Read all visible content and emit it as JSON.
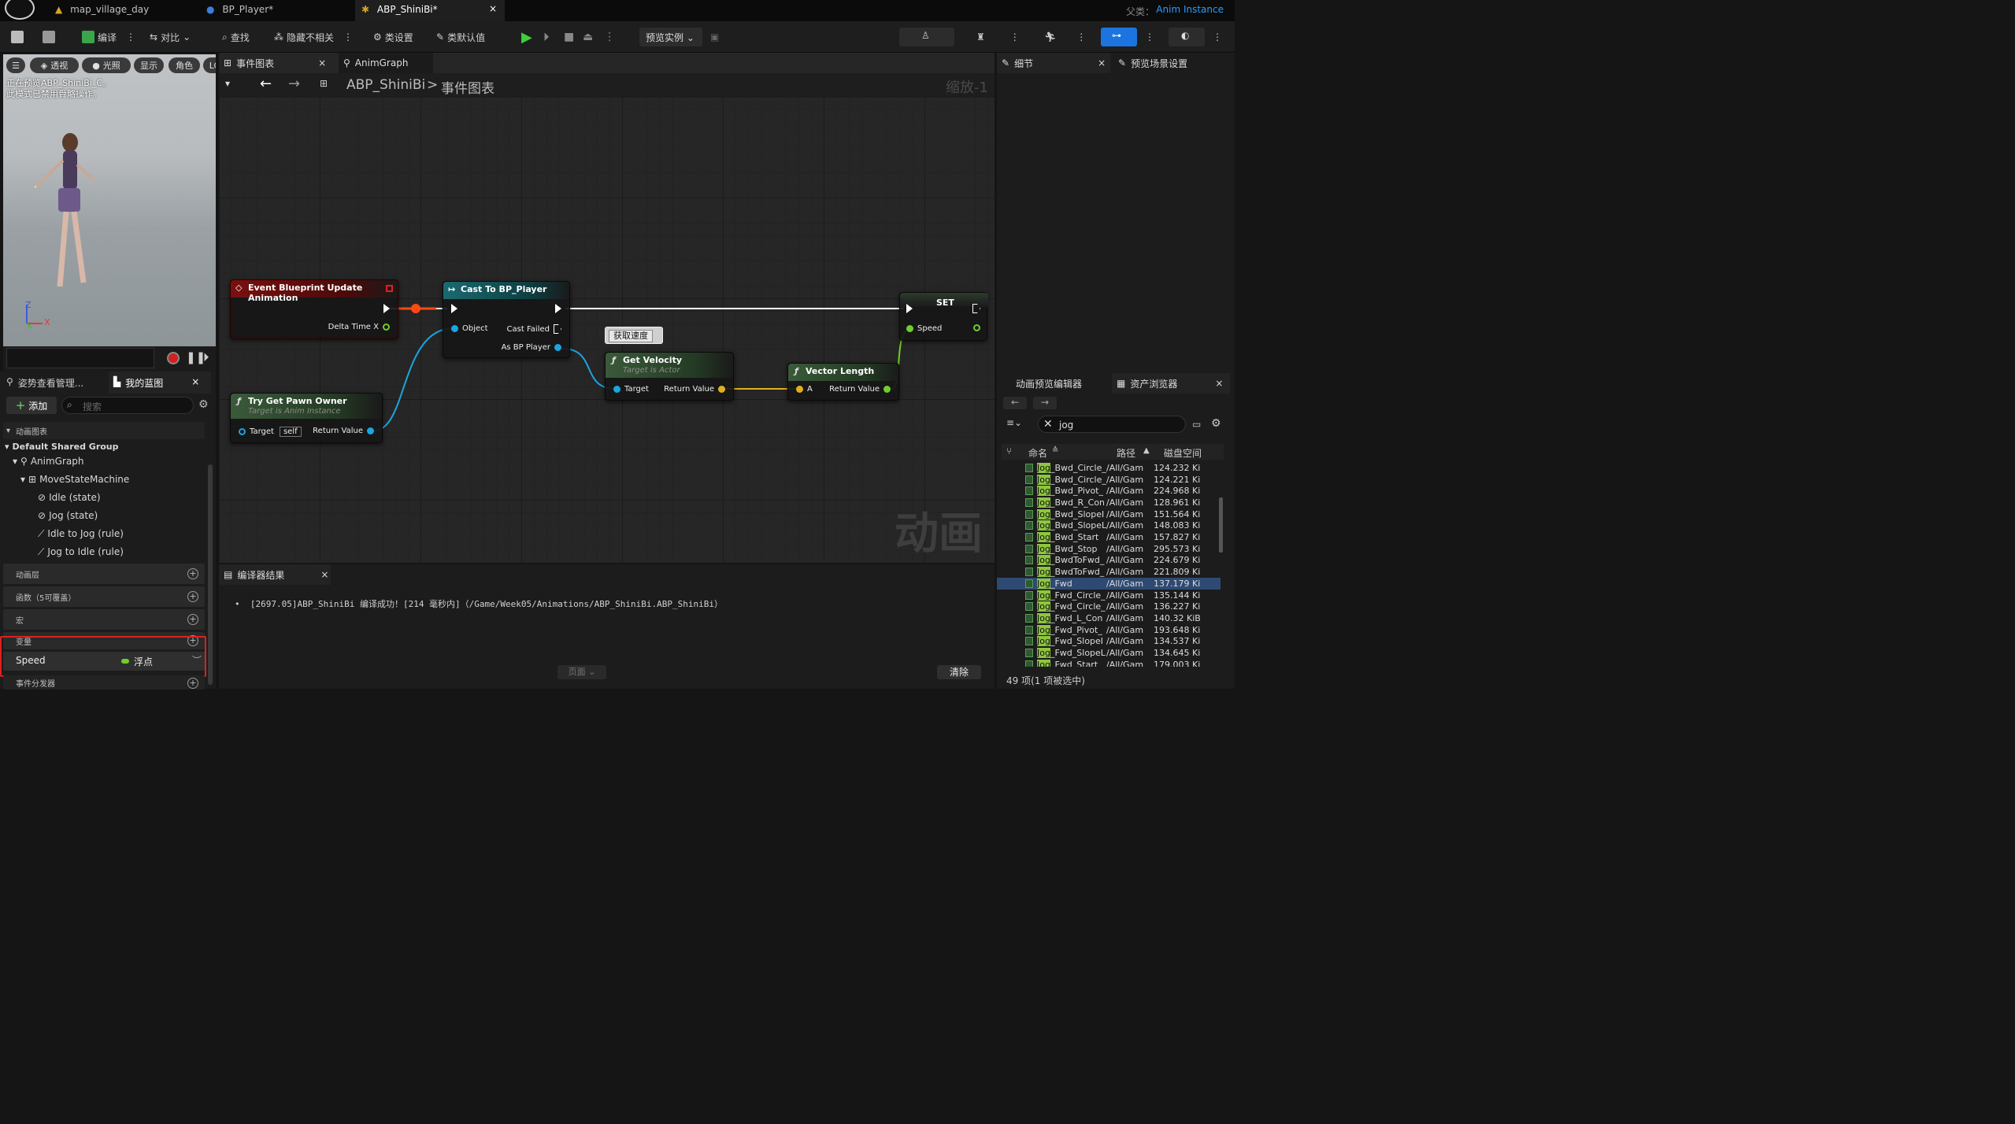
{
  "titlebar": {
    "tabs": [
      {
        "label": "map_village_day",
        "icon": "level-icon"
      },
      {
        "label": "BP_Player*",
        "icon": "blueprint-icon"
      },
      {
        "label": "ABP_ShiniBi*",
        "icon": "anim-blueprint-icon",
        "close": "×"
      }
    ],
    "parent_label": "父类：",
    "parent_value": "Anim Instance"
  },
  "toolbar": {
    "compile": "编译",
    "diff": "对比",
    "find": "查找",
    "hide_unrelated": "隐藏不相关",
    "class_settings": "类设置",
    "class_defaults": "类默认值",
    "preview_instance": "预览实例"
  },
  "viewport": {
    "buttons": [
      "透视",
      "光照",
      "显示",
      "角色",
      "LO"
    ],
    "info_line1": "正在预览ABP_ShiniBi_C。",
    "info_line2": "此模式已禁用骨骼操作。",
    "axis_z": "Z",
    "axis_x": "X"
  },
  "left_panel": {
    "tab_pose": "姿势查看管理...",
    "tab_blueprint": "我的蓝图",
    "add": "添加",
    "search_placeholder": "搜索",
    "section_anim_graph": "动画图表",
    "default_group": "Default Shared Group",
    "tree": [
      {
        "label": "AnimGraph",
        "indent": 1
      },
      {
        "label": "MoveStateMachine",
        "indent": 2
      },
      {
        "label": "Idle (state)",
        "indent": 3
      },
      {
        "label": "Jog (state)",
        "indent": 3
      },
      {
        "label": "Idle to Jog (rule)",
        "indent": 3
      },
      {
        "label": "Jog to Idle (rule)",
        "indent": 3
      }
    ],
    "section_layers": "动画层",
    "section_functions": "函数（5可覆盖）",
    "section_macros": "宏",
    "section_variables": "变量",
    "variable_name": "Speed",
    "variable_type": "浮点",
    "section_dispatchers": "事件分发器"
  },
  "graph": {
    "tab_event": "事件图表",
    "tab_anim": "AnimGraph",
    "breadcrumb_root": "ABP_ShiniBi",
    "breadcrumb_sep": ">",
    "breadcrumb_leaf": "事件图表",
    "zoom": "缩放-1",
    "watermark": "动画",
    "nodes": {
      "event": {
        "title": "Event Blueprint Update Animation",
        "pin_out": "Delta Time X"
      },
      "cast": {
        "title": "Cast To BP_Player",
        "pin_object": "Object",
        "pin_failed": "Cast Failed",
        "pin_as": "As BP Player"
      },
      "pawn": {
        "title": "Try Get Pawn Owner",
        "subtitle": "Target is Anim Instance",
        "pin_target": "Target",
        "pin_self": "self",
        "pin_ret": "Return Value"
      },
      "comment": "获取速度",
      "velocity": {
        "title": "Get Velocity",
        "subtitle": "Target is Actor",
        "pin_target": "Target",
        "pin_ret": "Return Value"
      },
      "vlength": {
        "title": "Vector Length",
        "pin_a": "A",
        "pin_ret": "Return Value"
      },
      "set": {
        "title": "SET",
        "pin_speed": "Speed"
      }
    }
  },
  "compiler": {
    "tab": "编译器结果",
    "message": "[2697.05]ABP_ShiniBi 编译成功！[214 毫秒内]（/Game/Week05/Animations/ABP_ShiniBi.ABP_ShiniBi）",
    "page": "页面",
    "clear": "清除"
  },
  "details": {
    "tab_details": "细节",
    "tab_preview": "预览场景设置"
  },
  "asset_panel": {
    "tab_preview_editor": "动画预览编辑器",
    "tab_browser": "资产浏览器",
    "search_value": "jog",
    "col_name": "命名",
    "col_path": "路径",
    "col_disk": "磁盘空间",
    "highlight": "Jog",
    "rows": [
      {
        "suffix": "_Bwd_Circle_",
        "path": "/All/Gam",
        "size": "124.232 Ki"
      },
      {
        "suffix": "_Bwd_Circle_",
        "path": "/All/Gam",
        "size": "124.221 Ki"
      },
      {
        "suffix": "_Bwd_Pivot_",
        "path": "/All/Gam",
        "size": "224.968 Ki"
      },
      {
        "suffix": "_Bwd_R_Con",
        "path": "/All/Gam",
        "size": "128.961 Ki"
      },
      {
        "suffix": "_Bwd_SlopeI",
        "path": "/All/Gam",
        "size": "151.564 Ki"
      },
      {
        "suffix": "_Bwd_SlopeL",
        "path": "/All/Gam",
        "size": "148.083 Ki"
      },
      {
        "suffix": "_Bwd_Start",
        "path": "/All/Gam",
        "size": "157.827 Ki"
      },
      {
        "suffix": "_Bwd_Stop",
        "path": "/All/Gam",
        "size": "295.573 Ki"
      },
      {
        "suffix": "_BwdToFwd_",
        "path": "/All/Gam",
        "size": "224.679 Ki"
      },
      {
        "suffix": "_BwdToFwd_",
        "path": "/All/Gam",
        "size": "221.809 Ki"
      },
      {
        "suffix": "_Fwd",
        "path": "/All/Gam",
        "size": "137.179 Ki",
        "selected": true
      },
      {
        "suffix": "_Fwd_Circle_",
        "path": "/All/Gam",
        "size": "135.144 Ki"
      },
      {
        "suffix": "_Fwd_Circle_",
        "path": "/All/Gam",
        "size": "136.227 Ki"
      },
      {
        "suffix": "_Fwd_L_Con",
        "path": "/All/Gam",
        "size": "140.32 KiB"
      },
      {
        "suffix": "_Fwd_Pivot_",
        "path": "/All/Gam",
        "size": "193.648 Ki"
      },
      {
        "suffix": "_Fwd_SlopeI",
        "path": "/All/Gam",
        "size": "134.537 Ki"
      },
      {
        "suffix": "_Fwd_SlopeL",
        "path": "/All/Gam",
        "size": "134.645 Ki"
      },
      {
        "suffix": "_Fwd_Start",
        "path": "/All/Gam",
        "size": "179.003 Ki"
      }
    ],
    "footer": "49 项(1 项被选中)"
  },
  "colors": {
    "accent": "#2d9bff",
    "highlight_red": "#e02020",
    "exec_wire": "#ffffff",
    "object_wire": "#1aa6e0",
    "float_wire": "#6ecf2a",
    "vector_wire": "#e0b020"
  }
}
